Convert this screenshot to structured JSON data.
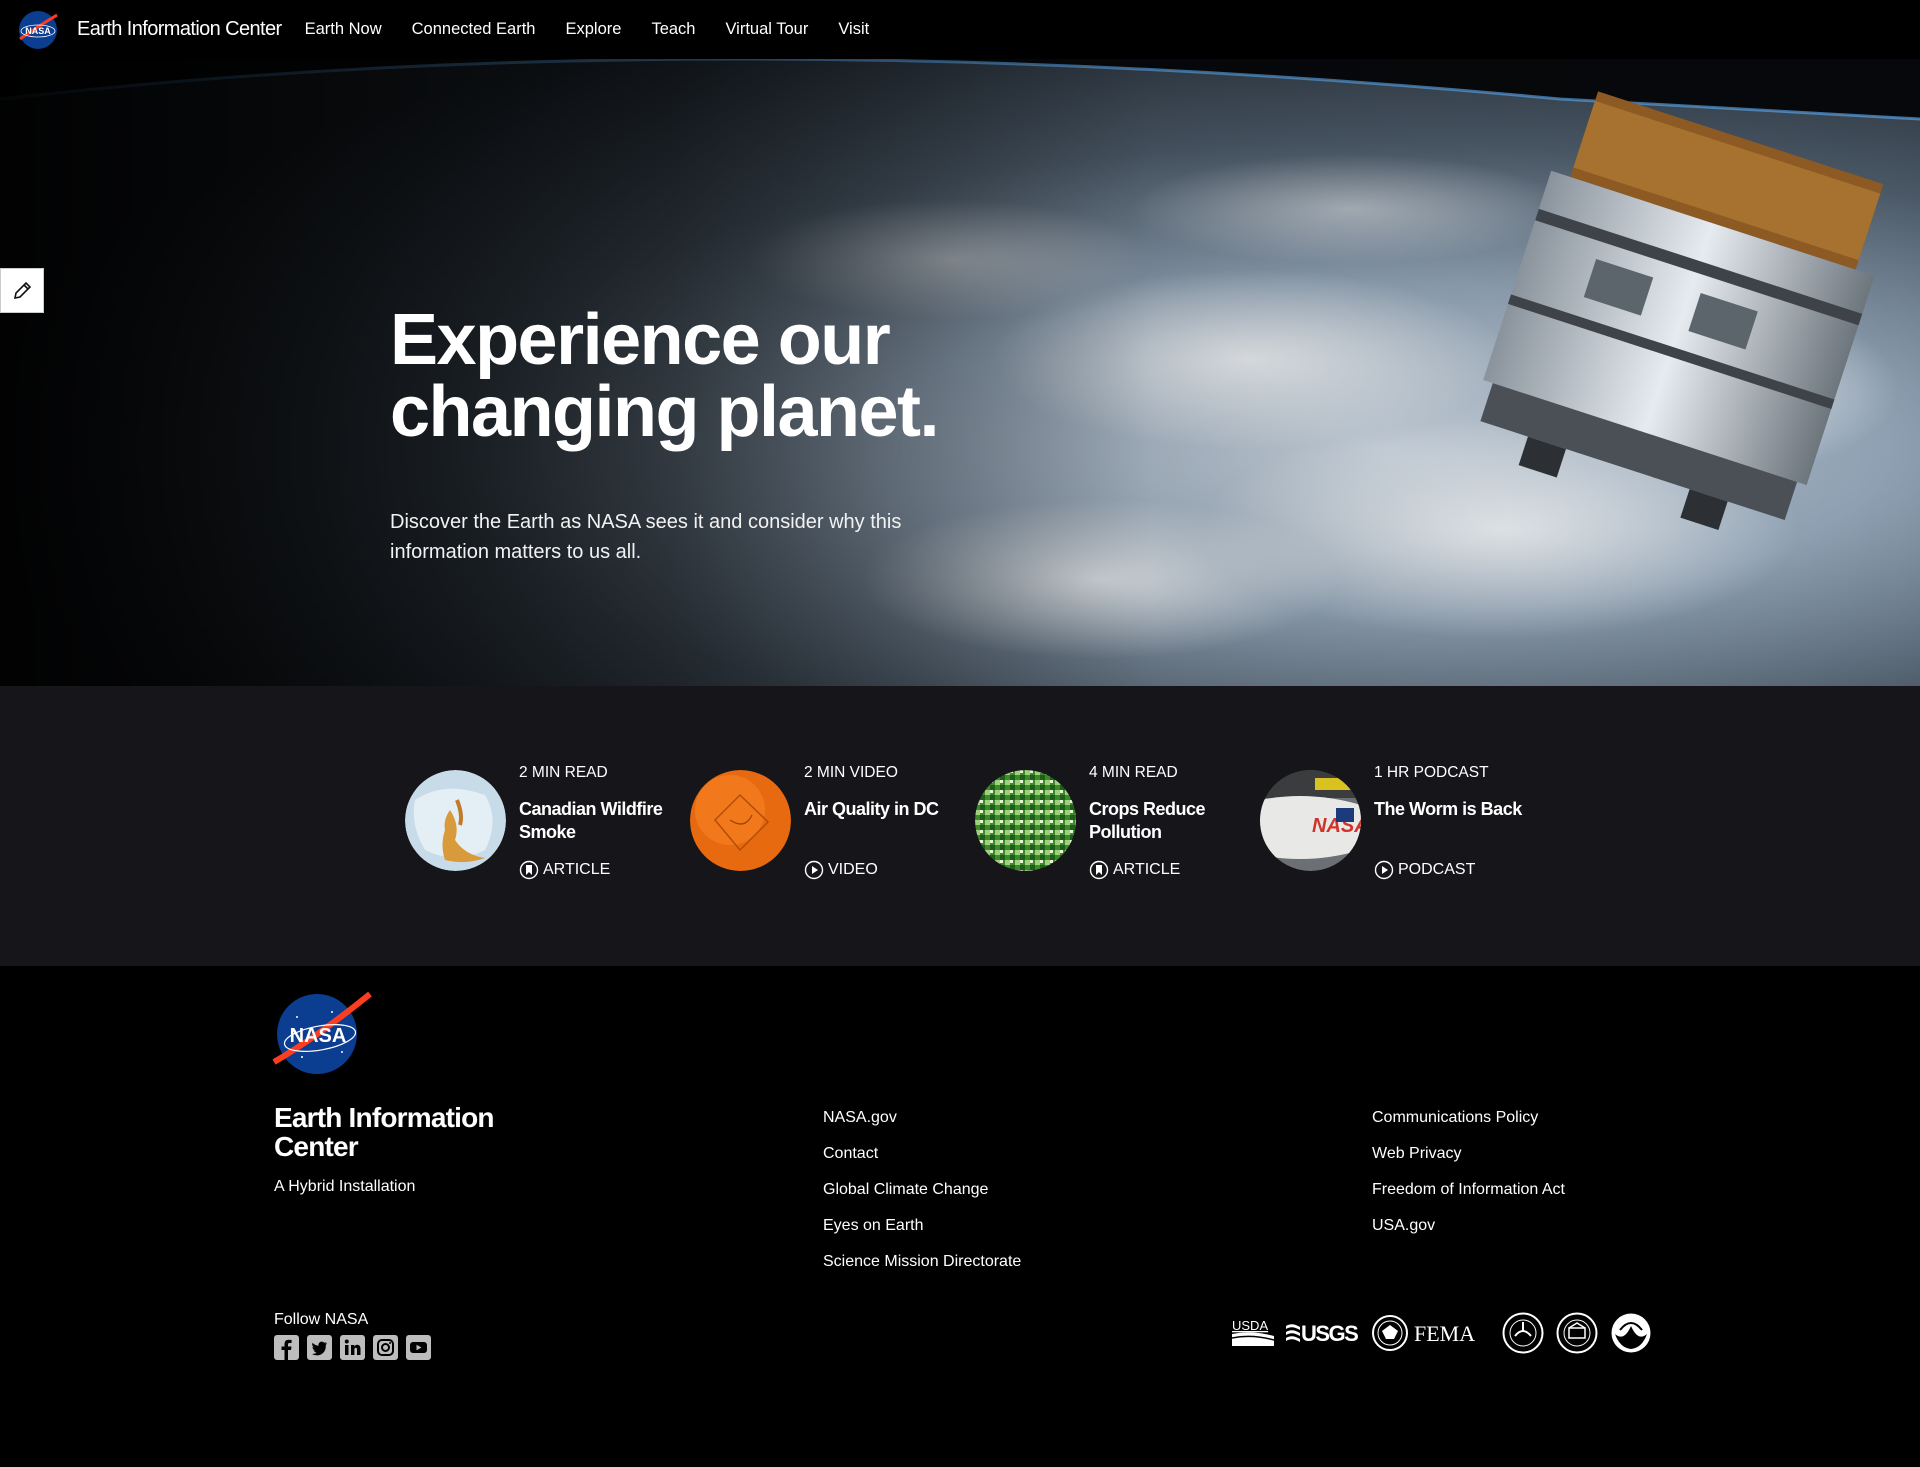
{
  "nav": {
    "logo_text": "NASA",
    "site_title": "Earth Information Center",
    "links": [
      "Earth Now",
      "Connected Earth",
      "Explore",
      "Teach",
      "Virtual Tour",
      "Visit"
    ]
  },
  "hero": {
    "title_line1": "Experience our",
    "title_line2": "changing planet.",
    "subtitle": "Discover the Earth as NASA sees it and consider why this information matters to us all."
  },
  "cards": [
    {
      "kicker": "2 MIN READ",
      "title": "Canadian Wildfire Smoke",
      "type": "ARTICLE",
      "type_icon": "bookmark-icon"
    },
    {
      "kicker": "2 MIN VIDEO",
      "title": "Air Quality in DC",
      "type": "VIDEO",
      "type_icon": "play-icon"
    },
    {
      "kicker": "4 MIN READ",
      "title": "Crops Reduce Pollution",
      "type": "ARTICLE",
      "type_icon": "bookmark-icon"
    },
    {
      "kicker": "1 HR PODCAST",
      "title": "The Worm is Back",
      "type": "PODCAST",
      "type_icon": "play-icon"
    }
  ],
  "footer": {
    "logo_text": "NASA",
    "title": "Earth Information Center",
    "tagline": "A Hybrid Installation",
    "links_col1": [
      "NASA.gov",
      "Contact",
      "Global Climate Change",
      "Eyes on Earth",
      "Science Mission Directorate"
    ],
    "links_col2": [
      "Communications Policy",
      "Web Privacy",
      "Freedom of Information Act",
      "USA.gov"
    ],
    "follow_label": "Follow NASA",
    "socials": [
      "facebook-icon",
      "twitter-icon",
      "linkedin-icon",
      "instagram-icon",
      "youtube-icon"
    ],
    "agencies": [
      "USDA",
      "USGS",
      "FEMA",
      "EPA",
      "USACE",
      "NOAA"
    ]
  },
  "colors": {
    "nav_bg": "#000000",
    "strip_bg": "#16161a",
    "nasa_blue": "#0b3d91",
    "nasa_red": "#fc3d21"
  }
}
